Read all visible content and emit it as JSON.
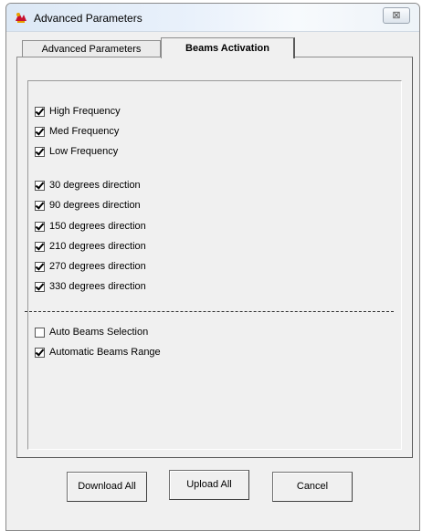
{
  "window": {
    "title": "Advanced Parameters",
    "close_glyph": "⊠"
  },
  "tabs": [
    {
      "label": "Advanced Parameters",
      "active": false
    },
    {
      "label": "Beams Activation",
      "active": true
    }
  ],
  "frequency_options": [
    {
      "label": "High Frequency",
      "checked": true
    },
    {
      "label": "Med Frequency",
      "checked": true
    },
    {
      "label": "Low Frequency",
      "checked": true
    }
  ],
  "direction_options": [
    {
      "label": "30 degrees direction",
      "checked": true
    },
    {
      "label": "90 degrees direction",
      "checked": true
    },
    {
      "label": "150 degrees direction",
      "checked": true
    },
    {
      "label": "210 degrees direction",
      "checked": true
    },
    {
      "label": "270 degrees direction",
      "checked": true
    },
    {
      "label": "330 degrees direction",
      "checked": true
    }
  ],
  "beam_options": [
    {
      "label": "Auto Beams Selection",
      "checked": false
    },
    {
      "label": "Automatic Beams Range",
      "checked": true
    }
  ],
  "buttons": {
    "download": "Download All",
    "upload": "Upload All",
    "cancel": "Cancel"
  }
}
